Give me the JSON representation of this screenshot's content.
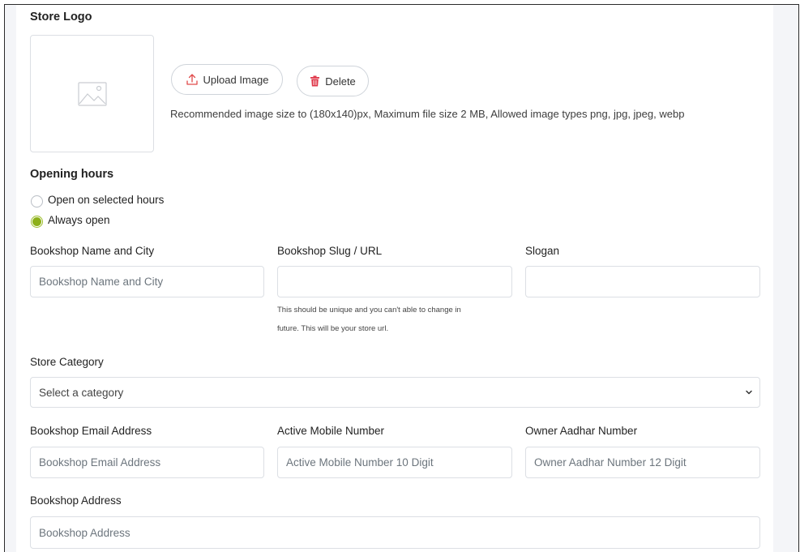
{
  "store_logo": {
    "heading": "Store Logo",
    "upload_label": "Upload Image",
    "delete_label": "Delete",
    "hint": "Recommended image size to (180x140)px, Maximum file size 2 MB, Allowed image types png, jpg, jpeg, webp"
  },
  "opening_hours": {
    "heading": "Opening hours",
    "options": [
      {
        "label": "Open on selected hours",
        "checked": false
      },
      {
        "label": "Always open",
        "checked": true
      }
    ]
  },
  "fields": {
    "name": {
      "label": "Bookshop Name and City",
      "placeholder": "Bookshop Name and City",
      "value": ""
    },
    "slug": {
      "label": "Bookshop Slug / URL",
      "placeholder": "",
      "value": "",
      "note_line1": "This should be unique and you can't able to change in",
      "note_line2": "future. This will be your store url."
    },
    "slogan": {
      "label": "Slogan",
      "placeholder": "",
      "value": ""
    },
    "category": {
      "label": "Store Category",
      "selected": "Select a category"
    },
    "email": {
      "label": "Bookshop Email Address",
      "placeholder": "Bookshop Email Address",
      "value": ""
    },
    "mobile": {
      "label": "Active Mobile Number",
      "placeholder": "Active Mobile Number 10 Digit",
      "value": ""
    },
    "aadhar": {
      "label": "Owner Aadhar Number",
      "placeholder": "Owner Aadhar Number 12 Digit",
      "value": ""
    },
    "address": {
      "label": "Bookshop Address",
      "placeholder": "Bookshop Address",
      "value": ""
    }
  },
  "colors": {
    "accent": "#8db01a",
    "delete_red": "#e0394b",
    "upload_red": "#e04a4a"
  }
}
